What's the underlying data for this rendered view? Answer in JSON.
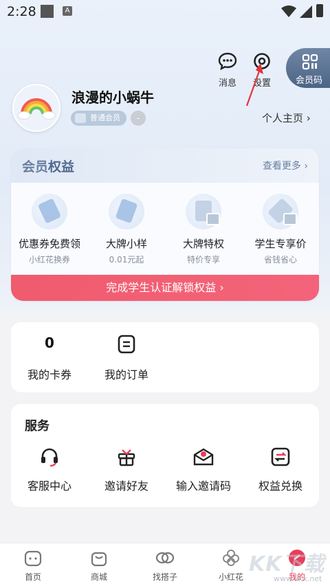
{
  "status_bar": {
    "time": "2:28",
    "a_icon": "A"
  },
  "header": {
    "messages_label": "消息",
    "settings_label": "设置",
    "member_code_label": "会员码"
  },
  "profile": {
    "username": "浪漫的小蜗牛",
    "level": "普通会员",
    "extra_badge": "-",
    "homepage_link": "个人主页 ›"
  },
  "benefits": {
    "title_part1": "会员",
    "title_part2": "权益",
    "more": "查看更多 ›",
    "items": [
      {
        "name": "优惠券免费领",
        "sub": "小红花换券"
      },
      {
        "name": "大牌小样",
        "sub": "0.01元起"
      },
      {
        "name": "大牌特权",
        "sub": "特价专享"
      },
      {
        "name": "学生专享价",
        "sub": "省钱省心"
      }
    ],
    "unlock_label": "完成学生认证解锁权益 ›"
  },
  "quick": [
    {
      "num": "0",
      "name": "我的卡券"
    },
    {
      "num": "",
      "name": "我的订单"
    }
  ],
  "services": {
    "title": "服务",
    "items": [
      {
        "name": "客服中心",
        "icon": "headset-icon"
      },
      {
        "name": "邀请好友",
        "icon": "gift-icon"
      },
      {
        "name": "输入邀请码",
        "icon": "envelope-icon"
      },
      {
        "name": "权益兑换",
        "icon": "exchange-icon"
      }
    ]
  },
  "tabs": [
    {
      "name": "首页"
    },
    {
      "name": "商城"
    },
    {
      "name": "找搭子"
    },
    {
      "name": "小红花"
    },
    {
      "name": "我的"
    }
  ],
  "watermark": {
    "main": "KK下载",
    "sub": "www.kkx.net"
  },
  "colors": {
    "accent": "#e83f5b",
    "member_blue": "#6a7fa0",
    "unlock_red": "#f05b6e"
  }
}
